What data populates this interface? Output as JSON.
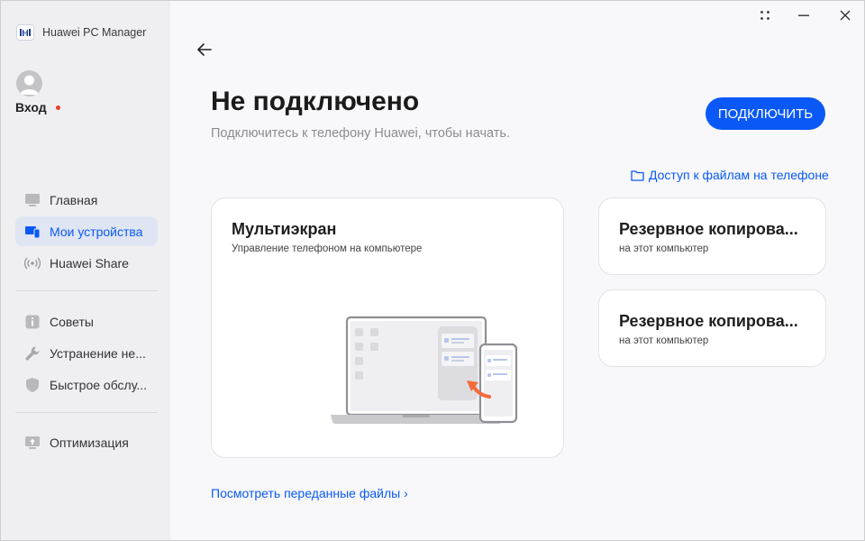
{
  "app": {
    "name": "Huawei PC Manager"
  },
  "user": {
    "login_label": "Вход"
  },
  "sidebar": {
    "items": [
      {
        "label": "Главная",
        "icon": "monitor-icon"
      },
      {
        "label": "Мои устройства",
        "icon": "devices-icon",
        "active": true
      },
      {
        "label": "Huawei Share",
        "icon": "wireless-icon"
      },
      {
        "label": "Советы",
        "icon": "info-icon"
      },
      {
        "label": "Устранение не...",
        "icon": "wrench-icon"
      },
      {
        "label": "Быстрое обслу...",
        "icon": "shield-icon"
      },
      {
        "label": "Оптимизация",
        "icon": "optimize-icon"
      }
    ]
  },
  "main": {
    "title": "Не подключено",
    "subtitle": "Подключитесь к телефону Huawei, чтобы начать.",
    "connect_button": "ПОДКЛЮЧИТЬ",
    "files_link": "Доступ к файлам на телефоне",
    "multiscreen": {
      "title": "Мультиэкран",
      "subtitle": "Управление телефоном на компьютере"
    },
    "backup_cards": [
      {
        "title": "Резервное копирова...",
        "subtitle": "на этот компьютер"
      },
      {
        "title": "Резервное копирова...",
        "subtitle": "на этот компьютер"
      }
    ],
    "transferred_link": "Посмотреть переданные файлы ›"
  },
  "colors": {
    "accent": "#0a59f7",
    "badge": "#e84026",
    "sidebar_bg": "#efeff2",
    "active_bg": "#dfe5f3"
  }
}
